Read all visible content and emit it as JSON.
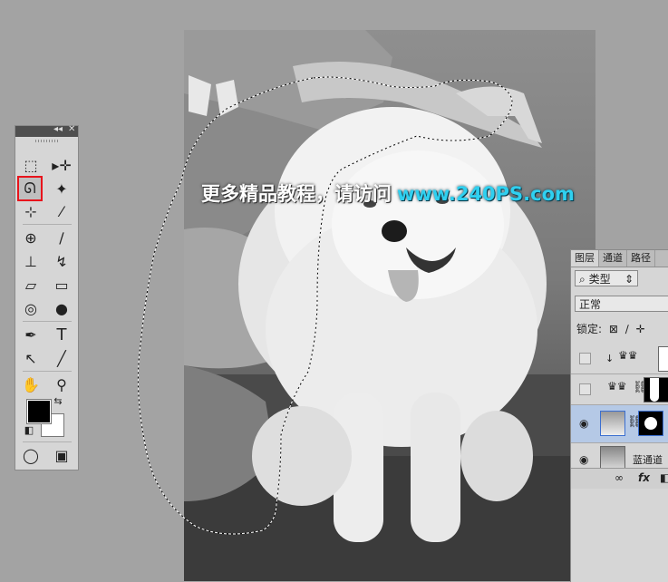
{
  "watermark": {
    "cn": "更多精品教程，请访问",
    "url": "www.240PS.com"
  },
  "toolbar": {
    "collapse_glyph": "◂◂",
    "close_glyph": "✕",
    "tools": [
      {
        "name": "marquee-tool-icon",
        "glyph": "⬚"
      },
      {
        "name": "move-tool-icon",
        "glyph": "▸✛"
      },
      {
        "name": "lasso-tool-icon",
        "glyph": "ᘏ",
        "selected": true
      },
      {
        "name": "magic-wand-tool-icon",
        "glyph": "✦"
      },
      {
        "name": "crop-tool-icon",
        "glyph": "⊹"
      },
      {
        "name": "eyedropper-tool-icon",
        "glyph": "⁄"
      },
      {
        "name": "healing-brush-tool-icon",
        "glyph": "⊕"
      },
      {
        "name": "brush-tool-icon",
        "glyph": "∕"
      },
      {
        "name": "stamp-tool-icon",
        "glyph": "⊥"
      },
      {
        "name": "history-brush-tool-icon",
        "glyph": "↯"
      },
      {
        "name": "eraser-tool-icon",
        "glyph": "▱"
      },
      {
        "name": "gradient-tool-icon",
        "glyph": "▭"
      },
      {
        "name": "blur-tool-icon",
        "glyph": "◎"
      },
      {
        "name": "dodge-tool-icon",
        "glyph": "●"
      },
      {
        "name": "pen-tool-icon",
        "glyph": "✒"
      },
      {
        "name": "type-tool-icon",
        "glyph": "T"
      },
      {
        "name": "path-selection-tool-icon",
        "glyph": "↖"
      },
      {
        "name": "line-tool-icon",
        "glyph": "╱"
      },
      {
        "name": "hand-tool-icon",
        "glyph": "✋"
      },
      {
        "name": "zoom-tool-icon",
        "glyph": "⚲"
      }
    ],
    "swap_glyph": "⇆",
    "default_glyph": "◧",
    "quickmask_glyph": "◯",
    "screenmode_glyph": "▣"
  },
  "layers_panel": {
    "tabs": [
      "图层",
      "通道",
      "路径"
    ],
    "filter_icon": "⌕",
    "filter_label": "类型",
    "filter_arrow": "⇕",
    "blend_mode": "正常",
    "lock_label": "锁定:",
    "lock_icons": [
      "⊠",
      "∕",
      "✛"
    ],
    "layers": [
      {
        "name": "layer-row-1",
        "vis": "",
        "link": "↓",
        "has_eye": false
      },
      {
        "name": "layer-row-2",
        "vis": "",
        "link": "",
        "has_eye": false
      },
      {
        "name": "layer-row-3",
        "vis": "👁",
        "link": "",
        "has_eye": true,
        "selected": true
      },
      {
        "name": "layer-row-4",
        "vis": "👁",
        "label": "蓝通道",
        "has_eye": true
      }
    ],
    "footer_icons": [
      "∞",
      "fx",
      "◧"
    ]
  }
}
